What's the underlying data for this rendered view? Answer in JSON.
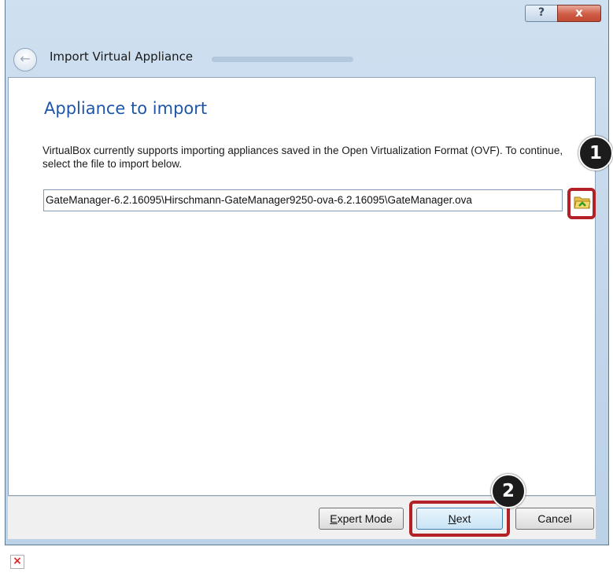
{
  "window": {
    "title": "Import Virtual Appliance",
    "help_label": "?",
    "close_label": "x",
    "back_icon": "back-arrow-icon"
  },
  "page": {
    "heading": "Appliance to import",
    "description": "VirtualBox currently supports importing appliances saved in the Open Virtualization Format (OVF). To continue, select the file to import below.",
    "file_path": "GateManager-6.2.16095\\Hirschmann-GateManager9250-ova-6.2.16095\\GateManager.ova",
    "browse_icon": "folder-open-icon"
  },
  "buttons": {
    "expert_first": "E",
    "expert_rest": "xpert Mode",
    "next_first": "N",
    "next_rest": "ext",
    "cancel": "Cancel"
  },
  "annotations": {
    "step1": "1",
    "step2": "2"
  },
  "colors": {
    "heading": "#1e57a8",
    "highlight": "#b32025",
    "badge": "#1c1c1c"
  }
}
